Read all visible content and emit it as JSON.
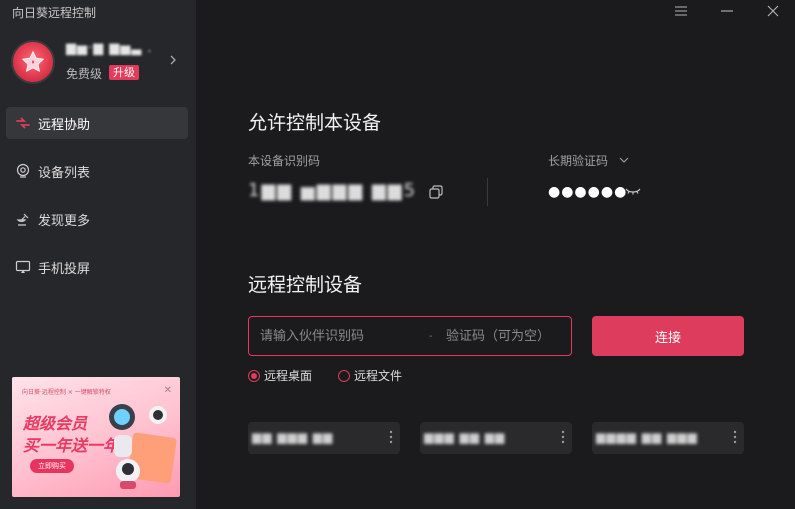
{
  "app": {
    "title": "向日葵远程控制"
  },
  "profile": {
    "username": "▆▅·▆ ▆▅▃ .",
    "tier": "免费级",
    "upgrade": "升级"
  },
  "sidebar": {
    "items": [
      {
        "label": "远程协助",
        "icon": "remote-assist-icon",
        "active": true
      },
      {
        "label": "设备列表",
        "icon": "device-list-icon",
        "active": false
      },
      {
        "label": "发现更多",
        "icon": "satellite-icon",
        "active": false
      },
      {
        "label": "手机投屏",
        "icon": "screen-cast-icon",
        "active": false
      }
    ]
  },
  "banner": {
    "small_text": "向日葵·远程控制 × 一键解锁特权",
    "close": "✕",
    "title1": "超级会员",
    "title2": "买一年送一年",
    "button": "立即购买"
  },
  "allow_control": {
    "title": "允许控制本设备",
    "id_label": "本设备识别码",
    "device_id": "1▆▆ ▅▆▆▆ ▆▆5",
    "code_label": "长期验证码",
    "code_value": "●●●●●●"
  },
  "remote_control": {
    "title": "远程控制设备",
    "partner_placeholder": "请输入伙伴识别码",
    "separator": "-",
    "code_placeholder": "验证码（可为空）",
    "connect": "连接",
    "modes": [
      {
        "label": "远程桌面",
        "selected": true
      },
      {
        "label": "远程文件",
        "selected": false
      }
    ]
  },
  "recent_devices": [
    {
      "name": "▆▆ ▆▆▆ ▆▆"
    },
    {
      "name": "▆▆▆  ▆▆  ▆▆"
    },
    {
      "name": "▆▆▆▆ ▆▆ ▆▆▆"
    }
  ],
  "colors": {
    "accent": "#de3c5c",
    "sidebar_bg": "#26272a",
    "main_bg": "#1b1b1d"
  }
}
